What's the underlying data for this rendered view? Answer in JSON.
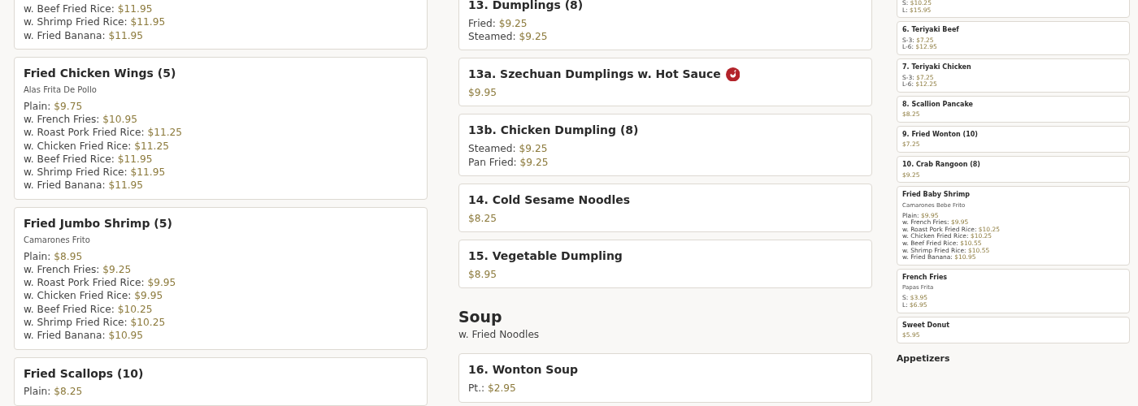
{
  "columns": [
    {
      "blocks": [
        {
          "kind": "card",
          "lines": [
            {
              "label": "w. Beef Fried Rice:",
              "price": "$11.95"
            },
            {
              "label": "w. Shrimp Fried Rice:",
              "price": "$11.95"
            },
            {
              "label": "w. Fried Banana:",
              "price": "$11.95"
            }
          ]
        },
        {
          "kind": "card",
          "title": "Fried Chicken Wings (5)",
          "subtitle": "Alas Frita De Pollo",
          "lines": [
            {
              "label": "Plain:",
              "price": "$9.75"
            },
            {
              "label": "w. French Fries:",
              "price": "$10.95"
            },
            {
              "label": "w. Roast Pork Fried Rice:",
              "price": "$11.25"
            },
            {
              "label": "w. Chicken Fried Rice:",
              "price": "$11.25"
            },
            {
              "label": "w. Beef Fried Rice:",
              "price": "$11.95"
            },
            {
              "label": "w. Shrimp Fried Rice:",
              "price": "$11.95"
            },
            {
              "label": "w. Fried Banana:",
              "price": "$11.95"
            }
          ]
        },
        {
          "kind": "card",
          "title": "Fried Jumbo Shrimp (5)",
          "subtitle": "Camarones Frito",
          "lines": [
            {
              "label": "Plain:",
              "price": "$8.95"
            },
            {
              "label": "w. French Fries:",
              "price": "$9.25"
            },
            {
              "label": "w. Roast Pork Fried Rice:",
              "price": "$9.95"
            },
            {
              "label": "w. Chicken Fried Rice:",
              "price": "$9.95"
            },
            {
              "label": "w. Beef Fried Rice:",
              "price": "$10.25"
            },
            {
              "label": "w. Shrimp Fried Rice:",
              "price": "$10.25"
            },
            {
              "label": "w. Fried Banana:",
              "price": "$10.95"
            }
          ]
        },
        {
          "kind": "card",
          "title": "Fried Scallops (10)",
          "lines": [
            {
              "label": "Plain:",
              "price": "$8.25"
            }
          ]
        }
      ]
    },
    {
      "blocks": [
        {
          "kind": "card",
          "title": "13. Dumplings (8)",
          "lines": [
            {
              "label": "Fried:",
              "price": "$9.25"
            },
            {
              "label": "Steamed:",
              "price": "$9.25"
            }
          ]
        },
        {
          "kind": "card",
          "title": "13a. Szechuan Dumplings w. Hot Sauce",
          "spicy": true,
          "lines": [
            {
              "price": "$9.95"
            }
          ]
        },
        {
          "kind": "card",
          "title": "13b. Chicken Dumpling (8)",
          "lines": [
            {
              "label": "Steamed:",
              "price": "$9.25"
            },
            {
              "label": "Pan Fried:",
              "price": "$9.25"
            }
          ]
        },
        {
          "kind": "card",
          "title": "14. Cold Sesame Noodles",
          "lines": [
            {
              "price": "$8.25"
            }
          ]
        },
        {
          "kind": "card",
          "title": "15. Vegetable Dumpling",
          "lines": [
            {
              "price": "$8.95"
            }
          ]
        },
        {
          "kind": "heading",
          "title": "Soup",
          "note": "w. Fried Noodles"
        },
        {
          "kind": "card",
          "title": "16. Wonton Soup",
          "lines": [
            {
              "label": "Pt.:",
              "price": "$2.95"
            }
          ]
        }
      ]
    },
    {
      "blocks": [
        {
          "kind": "card",
          "lines": [
            {
              "label": "S:",
              "price": "$10.25"
            },
            {
              "label": "L:",
              "price": "$15.95"
            }
          ]
        },
        {
          "kind": "card",
          "title": "6. Teriyaki Beef",
          "lines": [
            {
              "label": "S-3:",
              "price": "$7.25"
            },
            {
              "label": "L-6:",
              "price": "$12.95"
            }
          ]
        },
        {
          "kind": "card",
          "title": "7. Teriyaki Chicken",
          "lines": [
            {
              "label": "S-3:",
              "price": "$7.25"
            },
            {
              "label": "L-6:",
              "price": "$12.25"
            }
          ]
        },
        {
          "kind": "card",
          "title": "8. Scallion Pancake",
          "lines": [
            {
              "price": "$8.25"
            }
          ]
        },
        {
          "kind": "card",
          "title": "9. Fried Wonton (10)",
          "lines": [
            {
              "price": "$7.25"
            }
          ]
        },
        {
          "kind": "card",
          "title": "10. Crab Rangoon (8)",
          "lines": [
            {
              "price": "$9.25"
            }
          ]
        },
        {
          "kind": "card",
          "title": "Fried Baby Shrimp",
          "subtitle": "Camarones Bebe Frito",
          "lines": [
            {
              "label": "Plain:",
              "price": "$9.95"
            },
            {
              "label": "w. French Fries:",
              "price": "$9.95"
            },
            {
              "label": "w. Roast Pork Fried Rice:",
              "price": "$10.25"
            },
            {
              "label": "w. Chicken Fried Rice:",
              "price": "$10.25"
            },
            {
              "label": "w. Beef Fried Rice:",
              "price": "$10.55"
            },
            {
              "label": "w. Shrimp Fried Rice:",
              "price": "$10.55"
            },
            {
              "label": "w. Fried Banana:",
              "price": "$10.95"
            }
          ]
        },
        {
          "kind": "card",
          "title": "French Fries",
          "subtitle": "Papas Frita",
          "lines": [
            {
              "label": "S:",
              "price": "$3.95"
            },
            {
              "label": "L:",
              "price": "$6.95"
            }
          ]
        },
        {
          "kind": "card",
          "title": "Sweet Donut",
          "lines": [
            {
              "price": "$5.95"
            }
          ]
        },
        {
          "kind": "heading",
          "title": "Appetizers"
        }
      ]
    }
  ]
}
